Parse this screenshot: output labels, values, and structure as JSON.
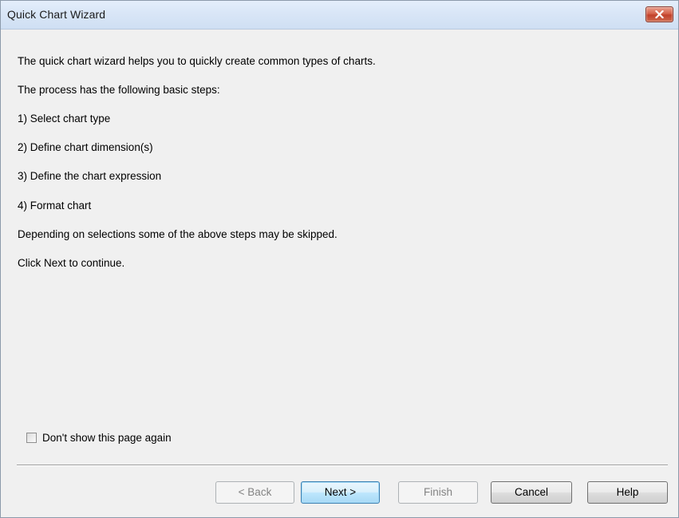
{
  "window": {
    "title": "Quick Chart Wizard"
  },
  "content": {
    "lines": [
      "The quick chart wizard helps you to quickly create common types of charts.",
      "The process has the following basic steps:",
      "1) Select chart type",
      "2) Define chart dimension(s)",
      "3) Define the chart expression",
      "4) Format chart",
      "Depending on selections some of the above steps may be skipped.",
      "Click Next to continue."
    ]
  },
  "options": {
    "dont_show_label": "Don't show this page again",
    "dont_show_checked": false
  },
  "buttons": {
    "back": "< Back",
    "next": "Next >",
    "finish": "Finish",
    "cancel": "Cancel",
    "help": "Help"
  },
  "icons": {
    "close": "close-icon"
  },
  "colors": {
    "titlebar": "#dbe7f7",
    "close_button": "#c9503a",
    "dialog_background": "#f0f0f0",
    "default_button_border": "#3c7fb1"
  }
}
